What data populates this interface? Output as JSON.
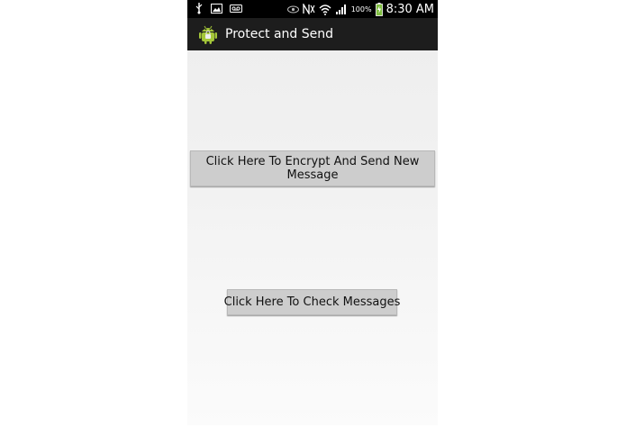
{
  "status_bar": {
    "battery_percent": "100%",
    "time": "8:30 AM",
    "icons": [
      "usb-icon",
      "image-icon",
      "voicemail-icon",
      "eye-icon",
      "nfc-icon",
      "wifi-icon",
      "signal-icon",
      "battery-icon"
    ]
  },
  "action_bar": {
    "app_icon": "android-app-icon",
    "title": "Protect and Send"
  },
  "main": {
    "encrypt_button_label": "Click Here To Encrypt And Send New Message",
    "check_button_label": "Click Here To Check Messages"
  },
  "colors": {
    "status_bar": "#000000",
    "action_bar": "#1d1d1d",
    "button_bg": "#cdcdcd",
    "battery": "#7fbf3f"
  }
}
